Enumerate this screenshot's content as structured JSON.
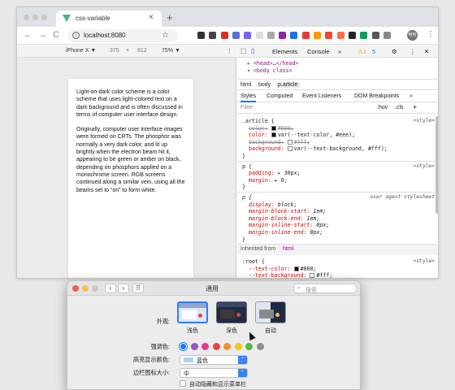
{
  "browser": {
    "tab_title": "css-variable",
    "tab_close": "×",
    "new_tab": "+",
    "url": "localhost:8080",
    "profile_initials": "哈哈",
    "menu_icon": "⋮",
    "nav": {
      "back": "←",
      "forward": "→",
      "reload": "C"
    },
    "extension_colors": [
      "#333333",
      "#444444",
      "#d93025",
      "#5b6ee1",
      "#7b61ff",
      "#dddddd",
      "#aaaaaa",
      "#8e24aa",
      "#1a73e8",
      "#e53935",
      "#ff9800",
      "#f44336",
      "#ff7043",
      "#222222",
      "#0f9d58",
      "#555555",
      "#888888"
    ]
  },
  "device_toolbar": {
    "device": "iPhone X ▼",
    "width": "375",
    "x": "×",
    "height": "812",
    "zoom": "75% ▼",
    "more": "⋮"
  },
  "article": {
    "paragraphs": [
      "Light-on-dark color scheme is a color scheme that uses light-colored text on a dark background and is often discussed in terms of computer user interface design.",
      "Originally, computer user interface images were formed on CRTs. The phosphor was normally a very dark color, and lit up brightly when the electron beam hit it, appearing to be green or amber on black, depending on phosphors applied on a monochrome screen. RGB screens continued along a similar vein, using all the beams set to “on” to form white."
    ]
  },
  "devtools": {
    "tabs": {
      "elements": "Elements",
      "console": "Console",
      "more": "»",
      "warnings": "⚠1",
      "errors": "5",
      "settings": "⚙",
      "dots": "⋮",
      "close": "✕"
    },
    "dom_lines": [
      "▸ <head>…</head>",
      "▾ <body class>"
    ],
    "breadcrumbs": [
      "html",
      "body",
      "p.article"
    ],
    "subtabs": [
      "Styles",
      "Computed",
      "Event Listeners",
      "DOM Breakpoints",
      "»"
    ],
    "filter_placeholder": "Filter",
    "filter_hov": ":hov",
    "filter_cls": ".cls",
    "filter_add": "+",
    "rules": [
      {
        "selector": ".article {",
        "source": "<style>",
        "decls": [
          {
            "prop": "color:",
            "val": "#000;",
            "swatch": "#000000",
            "struck": true
          },
          {
            "prop": "color:",
            "val": "var(--text-color, #eee);",
            "swatch": "#000000",
            "struck": false
          },
          {
            "prop": "background:",
            "val": "#fff;",
            "swatch": "#ffffff",
            "struck": true
          },
          {
            "prop": "background:",
            "val": "var(--text-background, #fff);",
            "swatch": "#ffffff",
            "struck": false
          }
        ]
      },
      {
        "selector": "p {",
        "source": "<style>",
        "decls": [
          {
            "prop": "padding:",
            "val": "▸ 30px;",
            "swatch": "",
            "struck": false
          },
          {
            "prop": "margin:",
            "val": "▸ 0;",
            "swatch": "",
            "struck": false
          }
        ]
      },
      {
        "selector": "p {",
        "source": "user agent stylesheet",
        "decls": [
          {
            "prop": "display:",
            "val": "block;",
            "swatch": "",
            "struck": false
          },
          {
            "prop": "margin-block-start:",
            "val": "1em;",
            "swatch": "",
            "struck": false
          },
          {
            "prop": "margin-block-end:",
            "val": "1em;",
            "swatch": "",
            "struck": false
          },
          {
            "prop": "margin-inline-start:",
            "val": "0px;",
            "swatch": "",
            "struck": false
          },
          {
            "prop": "margin-inline-end:",
            "val": "0px;",
            "swatch": "",
            "struck": false
          }
        ]
      }
    ],
    "inherited_label": "Inherited from",
    "inherited_tag": "html",
    "root_rule": {
      "selector": ":root {",
      "source": "<style>",
      "decls": [
        {
          "prop": "--text-color:",
          "val": "#000;",
          "swatch": "#000000"
        },
        {
          "prop": "--text-background:",
          "val": "#fff;",
          "swatch": "#ffffff"
        }
      ]
    },
    "closing_brace": "}"
  },
  "prefs": {
    "title": "通用",
    "search_placeholder": "搜索",
    "back": "‹",
    "forward": "›",
    "grid": "⠿",
    "appearance_label": "外观:",
    "appearance_options": [
      "浅色",
      "深色",
      "自动"
    ],
    "accent_label": "强调色:",
    "accent_colors": [
      "#1a7cf2",
      "#9b4fd1",
      "#e5398b",
      "#e5463d",
      "#f2902a",
      "#f5c51b",
      "#5bba3f",
      "#8e8e8e"
    ],
    "highlight_label": "高亮显示颜色:",
    "highlight_value": "蓝色",
    "sidebar_label": "边栏图标大小:",
    "sidebar_value": "中",
    "autohide_label": "自动隐藏和显示菜单栏",
    "popup_arrow": "⌃"
  }
}
